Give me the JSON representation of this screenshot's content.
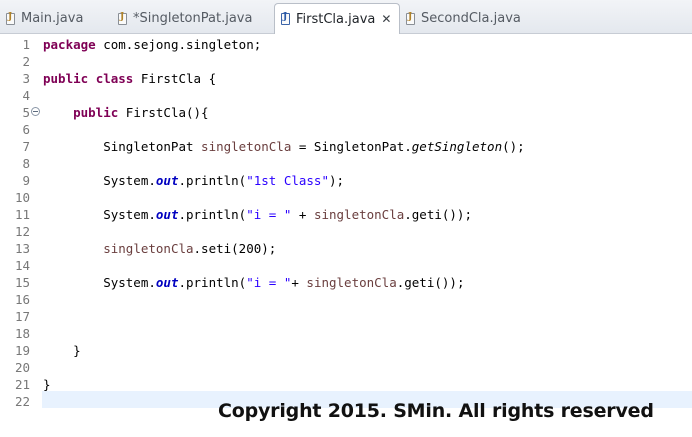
{
  "tabs": [
    {
      "label": "Main.java",
      "active": false
    },
    {
      "label": "*SingletonPat.java",
      "active": false
    },
    {
      "label": "FirstCla.java",
      "active": true
    },
    {
      "label": "SecondCla.java",
      "active": false
    }
  ],
  "icons": {
    "tab_file": "java-file-icon",
    "tab_close": "close-icon",
    "fold": "fold-collapse-icon"
  },
  "close_glyph": "✕",
  "line_numbers": [
    "1",
    "2",
    "3",
    "4",
    "5",
    "6",
    "7",
    "8",
    "9",
    "10",
    "11",
    "12",
    "13",
    "14",
    "15",
    "16",
    "17",
    "18",
    "19",
    "20",
    "21",
    "22"
  ],
  "code": {
    "l1": [
      {
        "t": "package",
        "k": "kw"
      },
      {
        "t": " com.sejong.singleton;",
        "k": "pl"
      }
    ],
    "l3": [
      {
        "t": "public",
        "k": "kw"
      },
      {
        "t": " ",
        "k": "pl"
      },
      {
        "t": "class",
        "k": "kw"
      },
      {
        "t": " FirstCla {",
        "k": "pl"
      }
    ],
    "l5": [
      {
        "t": "    ",
        "k": "pl"
      },
      {
        "t": "public",
        "k": "kw"
      },
      {
        "t": " FirstCla(){",
        "k": "pl"
      }
    ],
    "l7": [
      {
        "t": "        SingletonPat ",
        "k": "pl"
      },
      {
        "t": "singletonCla",
        "k": "fld"
      },
      {
        "t": " = SingletonPat.",
        "k": "pl"
      },
      {
        "t": "getSingleton",
        "k": "sm"
      },
      {
        "t": "();",
        "k": "pl"
      }
    ],
    "l9": [
      {
        "t": "        System.",
        "k": "pl"
      },
      {
        "t": "out",
        "k": "st"
      },
      {
        "t": ".println(",
        "k": "pl"
      },
      {
        "t": "\"1st Class\"",
        "k": "str"
      },
      {
        "t": ");",
        "k": "pl"
      }
    ],
    "l11": [
      {
        "t": "        System.",
        "k": "pl"
      },
      {
        "t": "out",
        "k": "st"
      },
      {
        "t": ".println(",
        "k": "pl"
      },
      {
        "t": "\"i = \"",
        "k": "str"
      },
      {
        "t": " + ",
        "k": "pl"
      },
      {
        "t": "singletonCla",
        "k": "fld"
      },
      {
        "t": ".geti());",
        "k": "pl"
      }
    ],
    "l13": [
      {
        "t": "        ",
        "k": "pl"
      },
      {
        "t": "singletonCla",
        "k": "fld"
      },
      {
        "t": ".seti(200);",
        "k": "pl"
      }
    ],
    "l15": [
      {
        "t": "        System.",
        "k": "pl"
      },
      {
        "t": "out",
        "k": "st"
      },
      {
        "t": ".println(",
        "k": "pl"
      },
      {
        "t": "\"i = \"",
        "k": "str"
      },
      {
        "t": "+ ",
        "k": "pl"
      },
      {
        "t": "singletonCla",
        "k": "fld"
      },
      {
        "t": ".geti());",
        "k": "pl"
      }
    ],
    "l19": [
      {
        "t": "    }",
        "k": "pl"
      }
    ],
    "l21": [
      {
        "t": "}",
        "k": "pl"
      }
    ]
  },
  "watermark": "Copyright 2015. SMin. All rights reserved"
}
